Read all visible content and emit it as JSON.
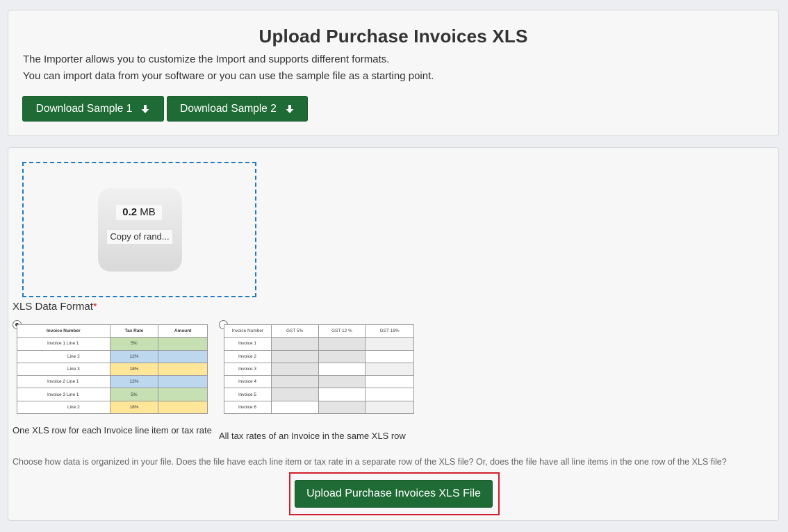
{
  "header": {
    "title": "Upload Purchase Invoices XLS",
    "desc_line1": "The Importer allows you to customize the Import and supports different formats.",
    "desc_line2": "You can import data from your software or you can use the sample file as a starting point.",
    "buttons": [
      {
        "label": "Download Sample 1",
        "icon": "arrow-down-icon"
      },
      {
        "label": "Download Sample 2",
        "icon": "arrow-down-icon"
      }
    ]
  },
  "dropzone": {
    "file_size_value": "0.2",
    "file_size_unit": "MB",
    "file_name": "Copy of rand..."
  },
  "format": {
    "label": "XLS Data Format",
    "required_mark": "*",
    "selected_option": 1,
    "option1": {
      "caption": "One XLS row for each Invoice line item or tax rate",
      "headers": [
        "Invoice Number",
        "Tax Rate",
        "Amount"
      ],
      "rows": [
        {
          "c1": "Invoice 1 Line 1",
          "c2": "5%"
        },
        {
          "c1": "Line 2",
          "c2": "12%"
        },
        {
          "c1": "Line 3",
          "c2": "18%"
        },
        {
          "c1": "Invoice 2 Line 1",
          "c2": "12%"
        },
        {
          "c1": "Invoice 3 Line 1",
          "c2": "5%"
        },
        {
          "c1": "Line 2",
          "c2": "18%"
        }
      ]
    },
    "option2": {
      "caption": "All tax rates of an Invoice in the same XLS row",
      "headers": [
        "Invoice Number",
        "GST 5%",
        "GST 12 %",
        "GST 18%"
      ],
      "rows": [
        "Invoice 1",
        "Invoice 2",
        "Invoice 3",
        "Invoice 4",
        "Invoice 5",
        "Invoice 6"
      ]
    }
  },
  "help_text": "Choose how data is organized in your file. Does the file have each line item or tax rate in a separate row of the XLS file? Or, does the file have all line items in the one row of the XLS file?",
  "upload_button": "Upload Purchase Invoices XLS File",
  "colors": {
    "primary_green": "#1e6b35",
    "dropzone_border": "#1e7ac4",
    "highlight_red": "#d21e2e",
    "green_cell": "#c6e0b4",
    "blue_cell": "#bdd7ee",
    "yellow_cell": "#ffe699",
    "gray_cell": "#e3e3e3"
  }
}
